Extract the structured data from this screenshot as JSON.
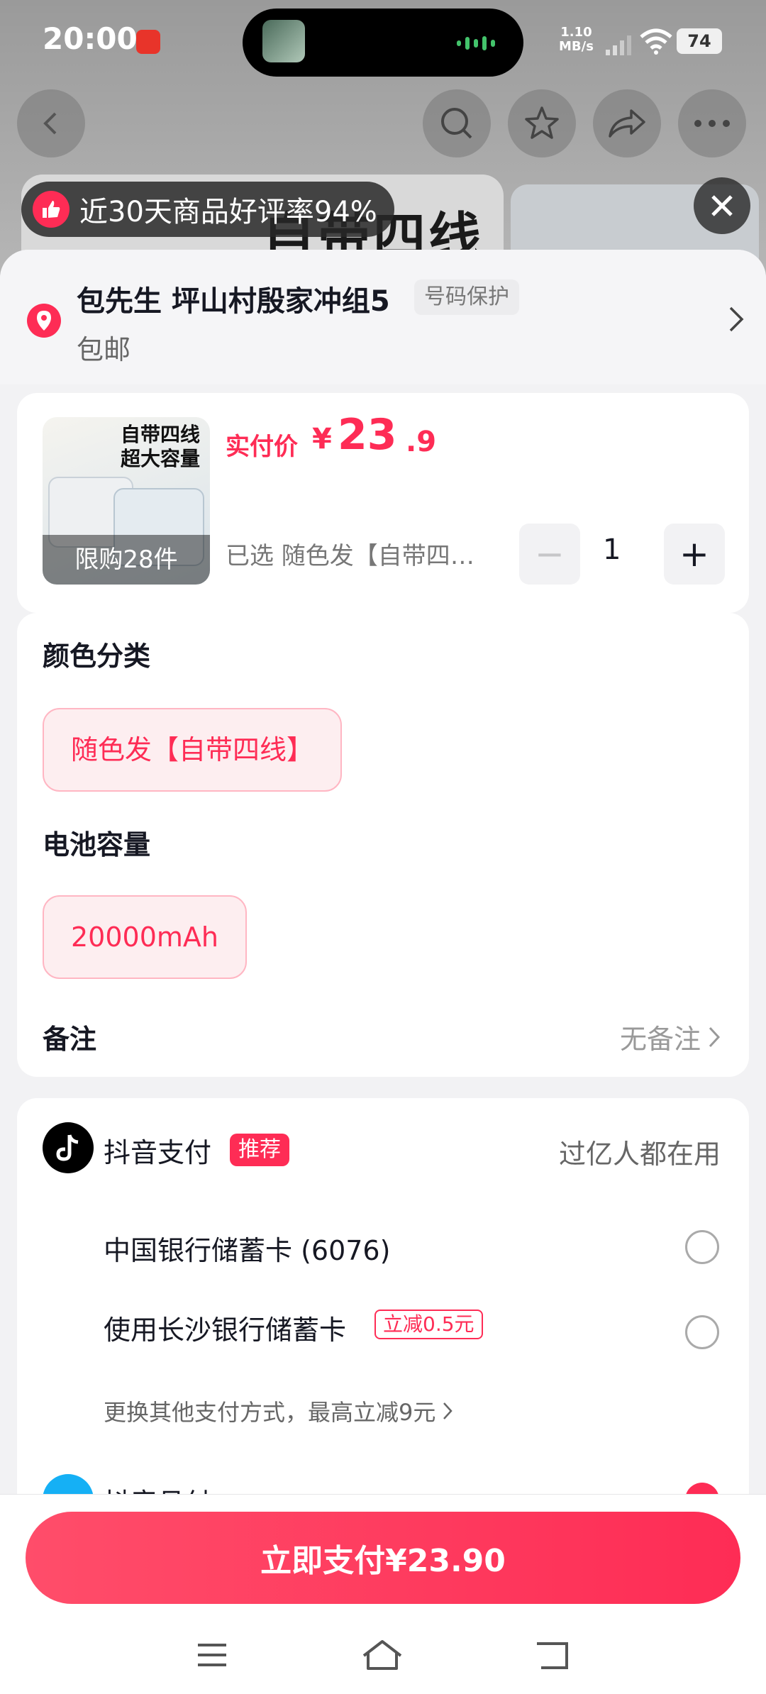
{
  "status_bar": {
    "time": "20:00",
    "net_speed_value": "1.10",
    "net_speed_unit": "MB/s",
    "battery": "74"
  },
  "background": {
    "banner_text": "自带四线",
    "rating_text": "近30天商品好评率94%"
  },
  "address": {
    "name_line": "包先生  坪山村殷家冲组5",
    "tag": "号码保护",
    "shipping": "包邮"
  },
  "product": {
    "image_title_line1": "自带四线",
    "image_title_line2": "超大容量",
    "limit": "限购28件",
    "price_label": "实付价",
    "price_symbol": "¥",
    "price_int": "23",
    "price_dec": ".9",
    "selected_text": "已选  随色发【自带四线】",
    "quantity": "1",
    "minus": "−",
    "plus": "+"
  },
  "spec": {
    "color_title": "颜色分类",
    "color_option": "随色发【自带四线】",
    "capacity_title": "电池容量",
    "capacity_option": "20000mAh",
    "remark_title": "备注",
    "remark_value": "无备注"
  },
  "payment": {
    "title": "抖音支付",
    "recommend_tag": "推荐",
    "right_text": "过亿人都在用",
    "option1": "中国银行储蓄卡 (6076)",
    "option2": "使用长沙银行储蓄卡",
    "option2_tag": "立减0.5元",
    "more_text": "更换其他支付方式，最高立减9元",
    "next_option": "抖音月付"
  },
  "bottom": {
    "pay_button": "立即支付¥23.90"
  },
  "colors": {
    "accent": "#fe2c55",
    "background": "#f2f2f4"
  }
}
